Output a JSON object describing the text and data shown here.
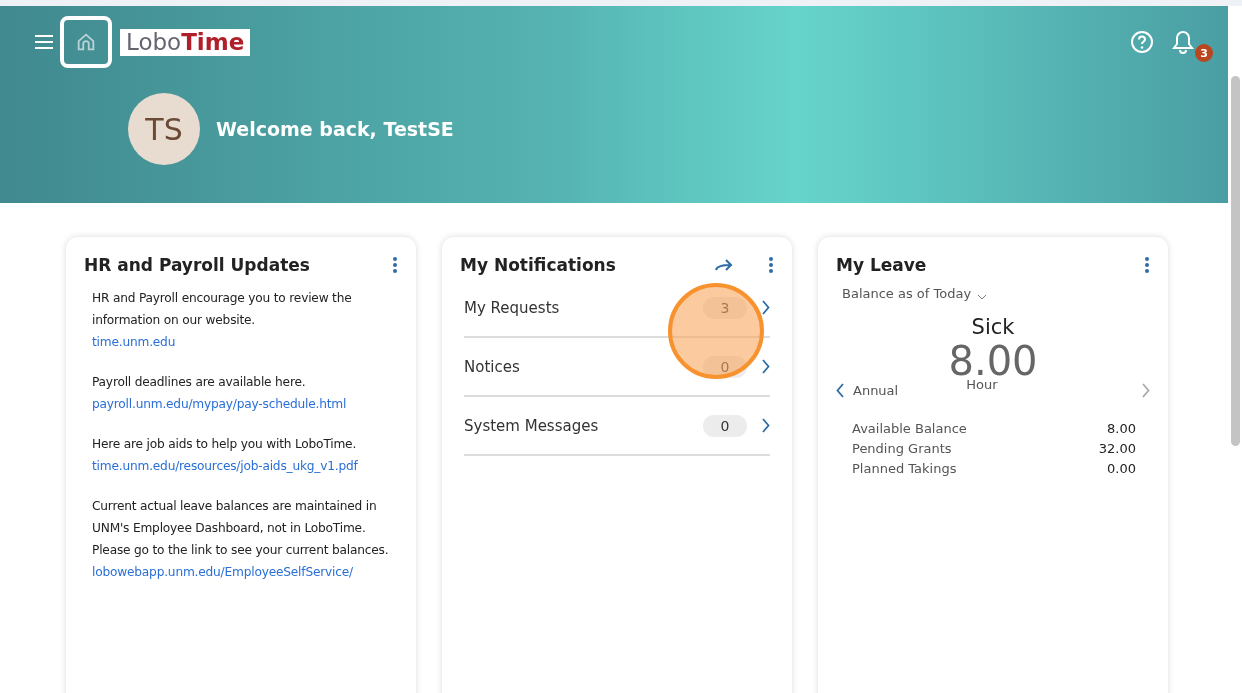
{
  "header": {
    "logo": {
      "part_1": "Lobo",
      "part_2": "Time"
    },
    "notification_count": "3",
    "avatar_initials": "TS",
    "welcome": "Welcome back, TestSE"
  },
  "hr_updates": {
    "title": "HR and Payroll Updates",
    "items": [
      {
        "text": "HR and Payroll encourage you to review the information on our website.",
        "link": "time.unm.edu"
      },
      {
        "text": "Payroll deadlines are available here.",
        "link": "payroll.unm.edu/mypay/pay-schedule.html"
      },
      {
        "text": "Here are job aids to help you with LoboTime.",
        "link": "time.unm.edu/resources/job-aids_ukg_v1.pdf"
      },
      {
        "text": "Current actual leave balances are maintained in UNM's Employee Dashboard, not in LoboTime. Please go to the link to see your current balances.",
        "link": "lobowebapp.unm.edu/EmployeeSelfService/"
      }
    ]
  },
  "notifications": {
    "title": "My Notifications",
    "rows": [
      {
        "label": "My Requests",
        "count": "3",
        "highlighted": true
      },
      {
        "label": "Notices",
        "count": "0",
        "highlighted": false
      },
      {
        "label": "System Messages",
        "count": "0",
        "highlighted": false
      }
    ]
  },
  "leave": {
    "title": "My Leave",
    "balance_selector": "Balance as of Today",
    "type": "Sick",
    "amount": "8.00",
    "unit": "Hour",
    "previous": {
      "label": "Annual",
      "disabled": false
    },
    "next": {
      "disabled": true
    },
    "rows": [
      {
        "label": "Available Balance",
        "value": "8.00"
      },
      {
        "label": "Pending Grants",
        "value": "32.00"
      },
      {
        "label": "Planned Takings",
        "value": "0.00"
      }
    ]
  }
}
